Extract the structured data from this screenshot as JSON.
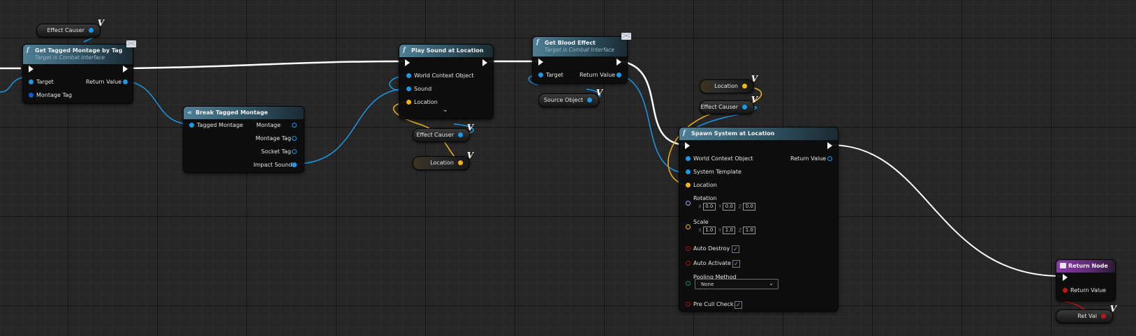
{
  "graph": {
    "effect_causer_var_1": "Effect Causer",
    "get_tagged_montage": {
      "title": "Get Tagged Montage by Tag",
      "subtitle": "Target is Combat Interface",
      "pins": {
        "target": "Target",
        "montage_tag": "Montage Tag",
        "return_value": "Return Value"
      }
    },
    "break_tagged_montage": {
      "title": "Break Tagged Montage",
      "pins": {
        "tagged_montage": "Tagged Montage",
        "montage": "Montage",
        "montage_tag": "Montage Tag",
        "socket_tag": "Socket Tag",
        "impact_sound": "Impact Sound"
      }
    },
    "play_sound": {
      "title": "Play Sound at Location",
      "pins": {
        "world_context": "World Context Object",
        "sound": "Sound",
        "location": "Location"
      }
    },
    "effect_causer_var_2": "Effect Causer",
    "location_var_1": "Location",
    "get_blood_effect": {
      "title": "Get Blood Effect",
      "subtitle": "Target is Combat Interface",
      "pins": {
        "target": "Target",
        "return_value": "Return Value"
      }
    },
    "source_object_var": "Source Object",
    "location_var_2": "Location",
    "effect_causer_var_3": "Effect Causer",
    "spawn_system": {
      "title": "Spawn System at Location",
      "pins": {
        "world_context": "World Context Object",
        "system_template": "System Template",
        "location": "Location",
        "rotation": "Rotation",
        "scale": "Scale",
        "auto_destroy": "Auto Destroy",
        "auto_activate": "Auto Activate",
        "pooling_method": "Pooling Method",
        "pre_cull_check": "Pre Cull Check",
        "return_value": "Return Value"
      },
      "rotation": {
        "x_label": "X",
        "y_label": "Y",
        "z_label": "Z",
        "x": "0.0",
        "y": "0.0",
        "z": "0.0"
      },
      "scale": {
        "x_label": "X",
        "y_label": "Y",
        "z_label": "Z",
        "x": "1.0",
        "y": "1.0",
        "z": "1.0"
      },
      "auto_destroy_checked": true,
      "auto_activate_checked": true,
      "pre_cull_check_checked": true,
      "pooling_method_value": "None"
    },
    "return_node": {
      "title": "Return Node",
      "pins": {
        "return_value": "Return Value"
      }
    },
    "ret_val_var": "Ret Val",
    "var_marker": "V",
    "func_icon": "f",
    "checkmark": "✓",
    "dropdown_icon": "⌄",
    "colors": {
      "exec": "#ffffff",
      "object_pin": "#1c98e8",
      "vector_pin": "#f2b41a",
      "bool_pin": "#c41515",
      "rotator_pin": "#9aa6ff",
      "header_function": "#4f7f95",
      "header_return": "#8a3aa8"
    }
  }
}
